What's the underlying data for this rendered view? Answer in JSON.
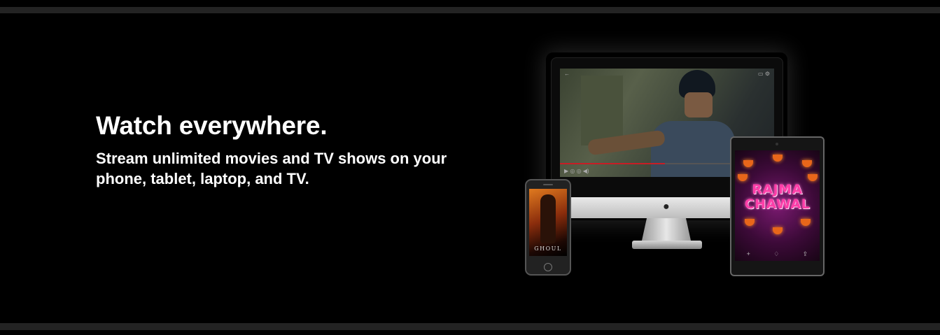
{
  "section": {
    "headline": "Watch everywhere.",
    "subline": "Stream unlimited movies and TV shows on your phone, tablet, laptop, and TV."
  },
  "devices": {
    "phone_poster_title": "GHOUL",
    "tablet_poster_title": "RAJMA CHAWAL"
  },
  "colors": {
    "background": "#000000",
    "divider": "#232323",
    "text": "#ffffff",
    "progress_accent": "#c81d25"
  },
  "icons": [
    "apple-icon",
    "back-arrow-icon",
    "cast-icon",
    "settings-icon",
    "play-icon",
    "volume-icon",
    "add-icon",
    "like-icon",
    "share-icon"
  ]
}
